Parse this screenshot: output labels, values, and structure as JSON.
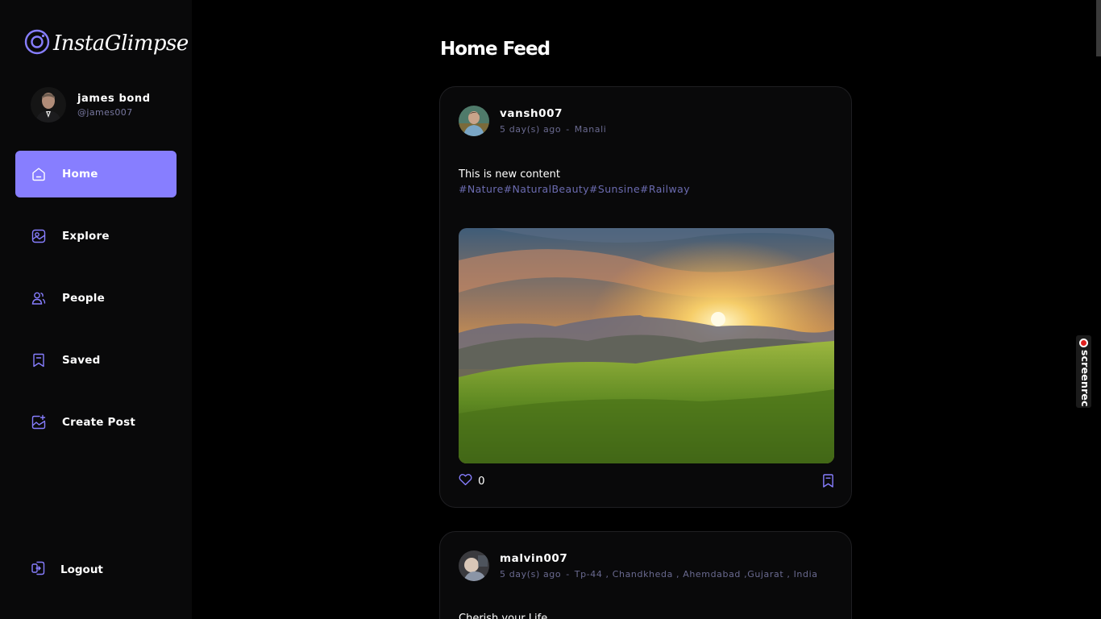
{
  "app": {
    "logo_text": "InstaGlimpse"
  },
  "user": {
    "name": "james bond",
    "handle": "@james007"
  },
  "nav": {
    "items": [
      {
        "label": "Home",
        "icon": "home-icon"
      },
      {
        "label": "Explore",
        "icon": "explore-icon"
      },
      {
        "label": "People",
        "icon": "people-icon"
      },
      {
        "label": "Saved",
        "icon": "saved-icon"
      },
      {
        "label": "Create Post",
        "icon": "create-post-icon"
      }
    ],
    "logout": "Logout"
  },
  "feed": {
    "title": "Home Feed",
    "posts": [
      {
        "username": "vansh007",
        "time": "5 day(s) ago",
        "separator": "-",
        "location": "Manali",
        "caption": "This is new content",
        "tags": "#Nature#NaturalBeauty#Sunsine#Railway",
        "likes": "0"
      },
      {
        "username": "malvin007",
        "time": "5 day(s) ago",
        "separator": "-",
        "location": "Tp-44 , Chandkheda , Ahemdabad ,Gujarat , India",
        "caption": "Cherish your Life",
        "tags": "",
        "likes": ""
      }
    ]
  },
  "overlay": {
    "screenrec_label": "screenrec"
  },
  "colors": {
    "accent": "#877eff",
    "sidebar_bg": "#09090a",
    "muted": "#6a6a90"
  }
}
